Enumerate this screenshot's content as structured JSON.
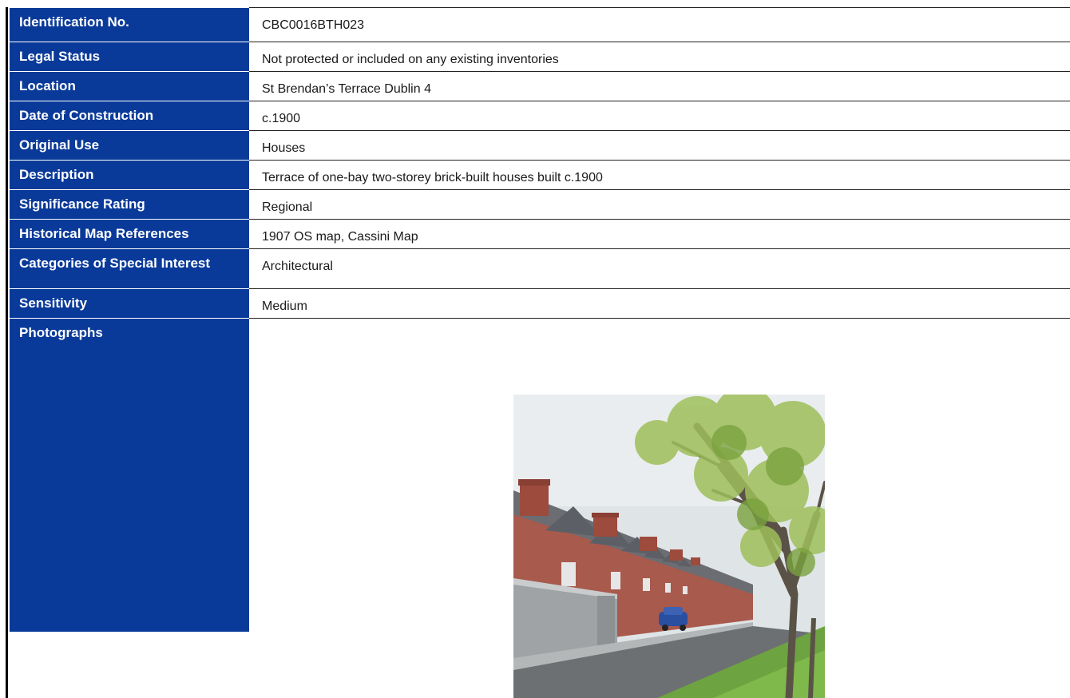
{
  "record": {
    "rows": [
      {
        "label": "Identification No.",
        "value": "CBC0016BTH023"
      },
      {
        "label": "Legal Status",
        "value": "Not protected or included on any existing inventories"
      },
      {
        "label": "Location",
        "value": "St Brendan’s Terrace Dublin 4"
      },
      {
        "label": "Date of Construction",
        "value": "c.1900"
      },
      {
        "label": "Original Use",
        "value": "Houses"
      },
      {
        "label": "Description",
        "value": "Terrace of one-bay two-storey brick-built houses built c.1900"
      },
      {
        "label": "Significance Rating",
        "value": "Regional"
      },
      {
        "label": "Historical Map References",
        "value": "1907 OS map, Cassini Map"
      },
      {
        "label": "Categories of Special Interest",
        "value": "Architectural"
      },
      {
        "label": "Sensitivity",
        "value": "Medium"
      },
      {
        "label": "Photographs",
        "value": ""
      }
    ]
  },
  "colors": {
    "label_background": "#0a3a99",
    "label_text": "#ffffff",
    "value_text": "#1a1a1a"
  }
}
